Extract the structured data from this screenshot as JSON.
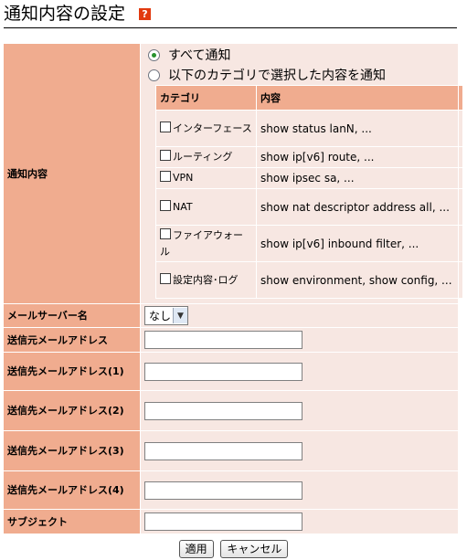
{
  "header": {
    "title": "通知内容の設定",
    "help_icon": "?"
  },
  "notify": {
    "label": "通知内容",
    "options": [
      {
        "label": "すべて通知",
        "selected": true
      },
      {
        "label": "以下のカテゴリで選択した内容を通知",
        "selected": false
      }
    ],
    "table_headers": {
      "category": "カテゴリ",
      "content": "内容"
    },
    "categories": [
      {
        "name": "インターフェース",
        "content": "show status lanN, ...",
        "checked": false
      },
      {
        "name": "ルーティング",
        "content": "show ip[v6] route, ...",
        "checked": false
      },
      {
        "name": "VPN",
        "content": "show ipsec sa, ...",
        "checked": false
      },
      {
        "name": "NAT",
        "content": "show nat descriptor address all, ...",
        "checked": false
      },
      {
        "name": "ファイアウォール",
        "content": "show ip[v6] inbound filter, ...",
        "checked": false
      },
      {
        "name": "設定内容･ログ",
        "content": "show environment, show config, ...",
        "checked": false
      }
    ]
  },
  "mail_server": {
    "label": "メールサーバー名",
    "value": "なし"
  },
  "fields": [
    {
      "label": "送信元メールアドレス",
      "value": ""
    },
    {
      "label": "送信先メールアドレス(1)",
      "value": ""
    },
    {
      "label": "送信先メールアドレス(2)",
      "value": ""
    },
    {
      "label": "送信先メールアドレス(3)",
      "value": ""
    },
    {
      "label": "送信先メールアドレス(4)",
      "value": ""
    },
    {
      "label": "サブジェクト",
      "value": ""
    }
  ],
  "buttons": {
    "apply": "適用",
    "cancel": "キャンセル"
  },
  "colors": {
    "label_bg": "#f0ac8f",
    "value_bg": "#f7e7e2",
    "help_icon": "#e23a0f"
  }
}
